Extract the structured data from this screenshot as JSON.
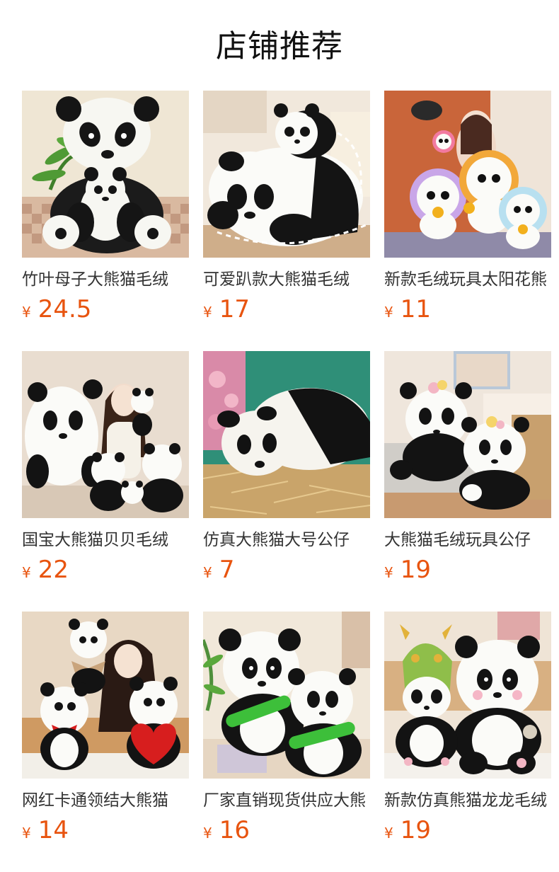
{
  "page": {
    "title": "店铺推荐"
  },
  "colors": {
    "price": "#e8540f",
    "title": "#111111",
    "name": "#333333"
  },
  "currency_symbol": "¥",
  "products": [
    {
      "name": "竹叶母子大熊猫毛绒",
      "price": "24.5",
      "image": "panda-mother-child-bamboo"
    },
    {
      "name": "可爱趴款大熊猫毛绒",
      "price": "17",
      "image": "panda-lying-with-baby"
    },
    {
      "name": "新款毛绒玩具太阳花熊",
      "price": "11",
      "image": "sunflower-panda-family"
    },
    {
      "name": "国宝大熊猫贝贝毛绒",
      "price": "22",
      "image": "panda-family-with-girl"
    },
    {
      "name": "仿真大熊猫大号公仔",
      "price": "7",
      "image": "panda-lying-on-straw"
    },
    {
      "name": "大熊猫毛绒玩具公仔",
      "price": "19",
      "image": "panda-pair-with-flowers"
    },
    {
      "name": "网红卡通领结大熊猫",
      "price": "14",
      "image": "panda-bowtie-heart-with-girl"
    },
    {
      "name": "厂家直销现货供应大熊",
      "price": "16",
      "image": "panda-holding-bamboo"
    },
    {
      "name": "新款仿真熊猫龙龙毛绒",
      "price": "19",
      "image": "panda-dragon-hat"
    }
  ]
}
